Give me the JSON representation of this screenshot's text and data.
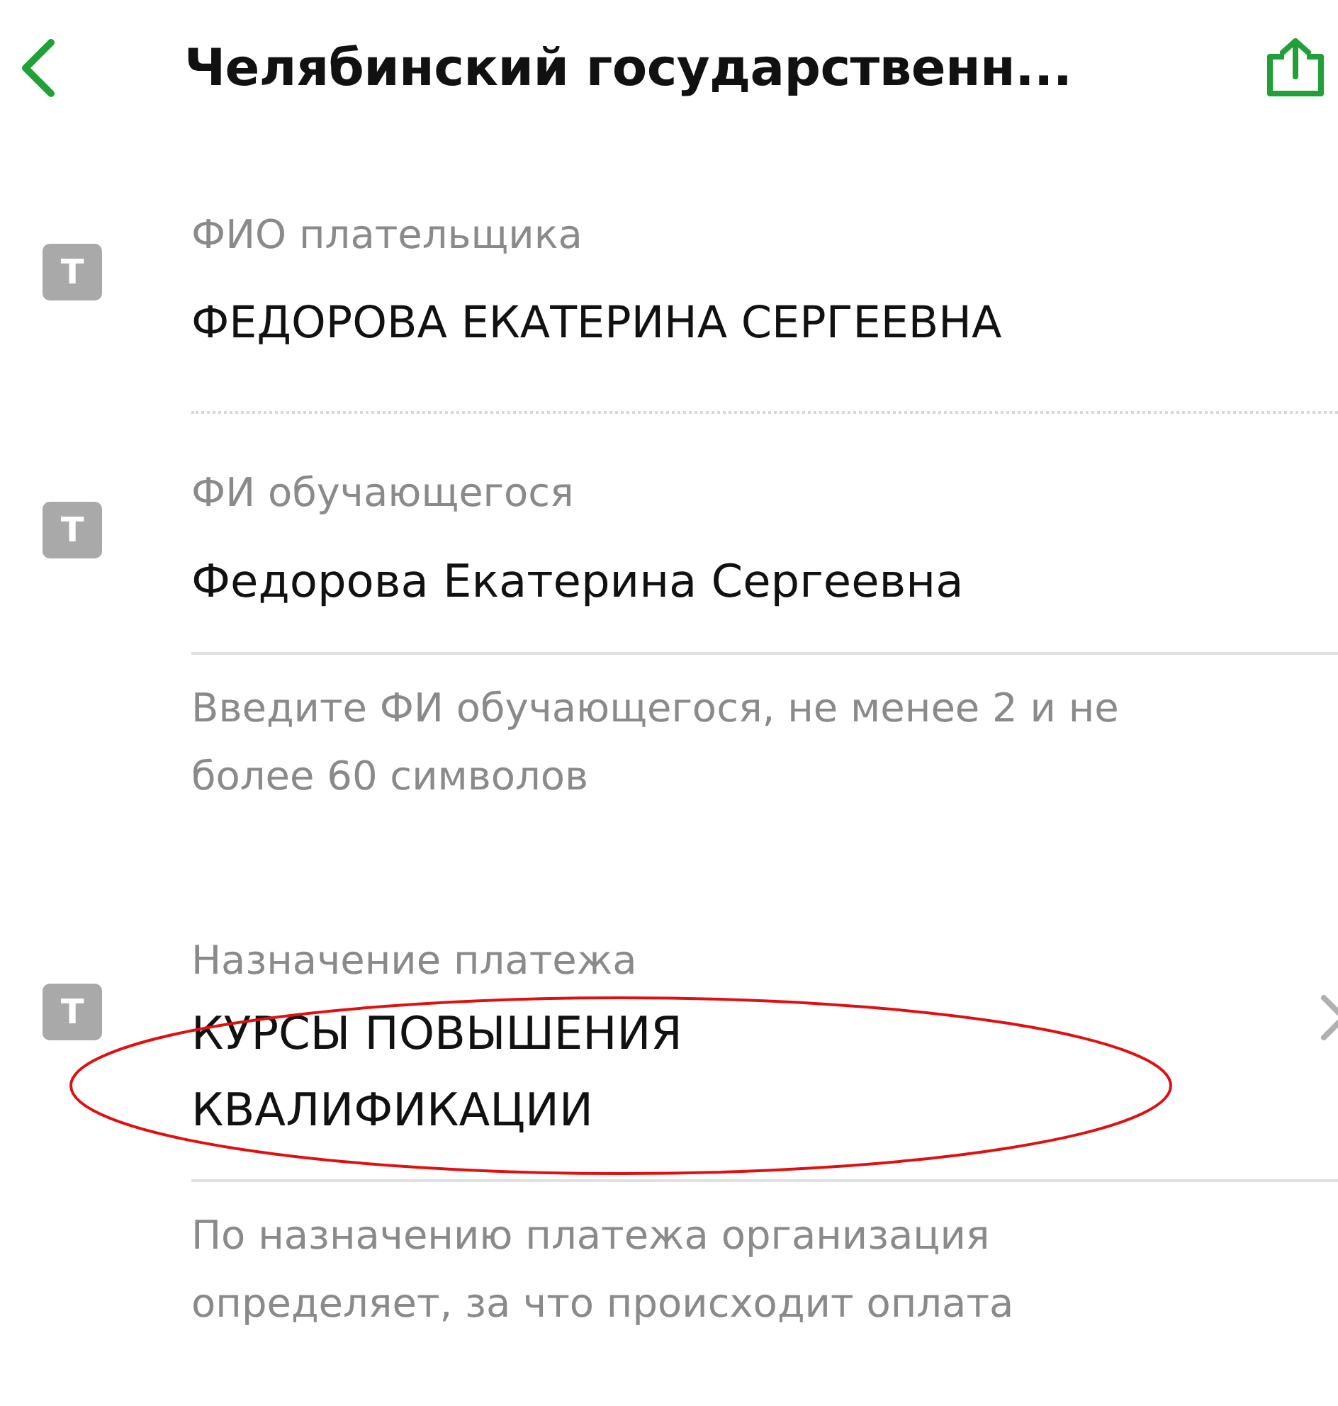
{
  "header": {
    "title": "Челябинский государственн..."
  },
  "fields": [
    {
      "kind": "readonly",
      "badge": "T",
      "label": "ФИО плательщика",
      "value": "ФЕДОРОВА ЕКАТЕРИНА СЕРГЕЕВНА"
    },
    {
      "kind": "input",
      "badge": "T",
      "label": "ФИ обучающегося",
      "value": "Федорова Екатерина Сергеевна",
      "hint": "Введите ФИ обучающегося, не менее 2 и не более 60 символов"
    },
    {
      "kind": "select",
      "badge": "T",
      "label": "Назначение платежа",
      "value": "КУРСЫ ПОВЫШЕНИЯ КВАЛИФИКАЦИИ",
      "hint": "По назначению платежа организация определяет, за что происходит оплата",
      "circled": true
    }
  ]
}
